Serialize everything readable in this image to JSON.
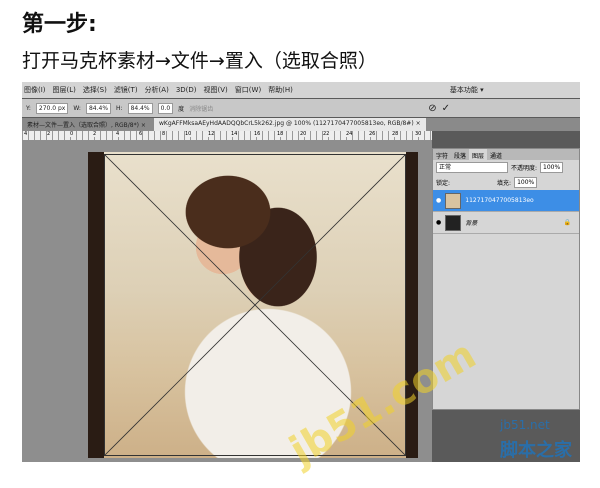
{
  "title": "第一步:",
  "subtitle": "打开马克杯素材→文件→置入（选取合照）",
  "menu": [
    "图像(I)",
    "图层(L)",
    "选择(S)",
    "滤镜(T)",
    "分析(A)",
    "3D(D)",
    "视图(V)",
    "窗口(W)",
    "帮助(H)",
    "基本功能 ▾"
  ],
  "options": {
    "y_label": "Y:",
    "y": "270.0 px",
    "w_label": "W:",
    "w": "84.4%",
    "h_label": "H:",
    "h": "84.4%",
    "angle": "0.0",
    "deg": "度",
    "interp": "消除锯齿",
    "cancel": "⊘",
    "commit": "✓"
  },
  "tabs": [
    "素材—文件—置入（选取合照）, RGB/8*) ×",
    "wKgAFFMksaAEyHdAADQQbCrL5k262.jpg @ 100% (1127170477005813eo, RGB/8#) ×"
  ],
  "ruler": [
    "4",
    "2",
    "0",
    "2",
    "4",
    "6",
    "8",
    "10",
    "12",
    "14",
    "16",
    "18",
    "20",
    "22",
    "24",
    "26",
    "28",
    "30"
  ],
  "panel": {
    "tabs": [
      "字符",
      "段落",
      "图层",
      "通道"
    ],
    "blend": "正常",
    "opacity_label": "不透明度:",
    "opacity": "100%",
    "lock_label": "锁定:",
    "fill_label": "填充:",
    "fill": "100%",
    "layers": [
      {
        "name": "1127170477005813eo",
        "selected": true
      },
      {
        "name": "背景",
        "selected": false
      }
    ]
  },
  "watermark": {
    "site": "jb51.net",
    "name": "脚本之家",
    "ghost": "jb51.com"
  }
}
